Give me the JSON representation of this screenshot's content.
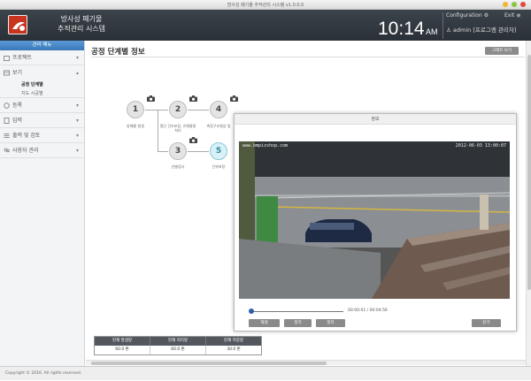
{
  "window": {
    "title": "방사성 폐기물 추적관리 시스템 v1.0.0.0"
  },
  "header": {
    "app_title_line1": "방사성 폐기물",
    "app_title_line2": "추적관리 시스템",
    "clock_time": "10:14",
    "clock_ampm": "AM",
    "configuration_label": "Configuration",
    "exit_label": "Exit",
    "user_label": "admin [프로그램 관리자]"
  },
  "sidebar": {
    "header": "관리 메뉴",
    "items": [
      {
        "label": "프로젝트",
        "icon": "folder-icon",
        "chevron": "▾"
      },
      {
        "label": "보기",
        "icon": "view-icon",
        "chevron": "▴"
      },
      {
        "label": "등록",
        "icon": "register-icon",
        "chevron": "▾"
      },
      {
        "label": "입력",
        "icon": "input-icon",
        "chevron": "▾"
      },
      {
        "label": "출력 및 검토",
        "icon": "list-icon",
        "chevron": "▾"
      },
      {
        "label": "사용자 관리",
        "icon": "user-icon",
        "chevron": "▾"
      }
    ],
    "subitems": [
      {
        "label": "공정 단계별"
      },
      {
        "label": "지도 시공별"
      }
    ]
  },
  "main": {
    "page_title": "공정 단계별 정보",
    "top_button": "그래프 보기",
    "nodes": [
      {
        "num": "1",
        "label": "방폐물 발생"
      },
      {
        "num": "2",
        "label": "절단 건조포장, 유해물질 처리"
      },
      {
        "num": "4",
        "label": "측정구조형상 및"
      },
      {
        "num": "3",
        "label": "선별검사"
      },
      {
        "num": "5",
        "label": "단위포장"
      }
    ],
    "stats": {
      "headers": [
        "현재 발생량",
        "현재 처리량",
        "현재 저장량"
      ],
      "values": [
        "60.0 톤",
        "60.0 톤",
        "30.0 톤"
      ]
    }
  },
  "dialog": {
    "title": "정보",
    "osd_left": "www.bmpizshop.com",
    "osd_right": "2012-06-03 13:00:07",
    "time": "00:00:01 / 00:04:56",
    "progress_fraction": 0.003,
    "buttons": [
      "재생",
      "정지",
      "정지"
    ],
    "close_button": "닫기"
  },
  "footer": {
    "text": "Copyright © 2016. All rights reserved."
  },
  "colors": {
    "accent": "#3a78b8",
    "header_bg": "#2f363d",
    "logo": "#c8341e"
  }
}
